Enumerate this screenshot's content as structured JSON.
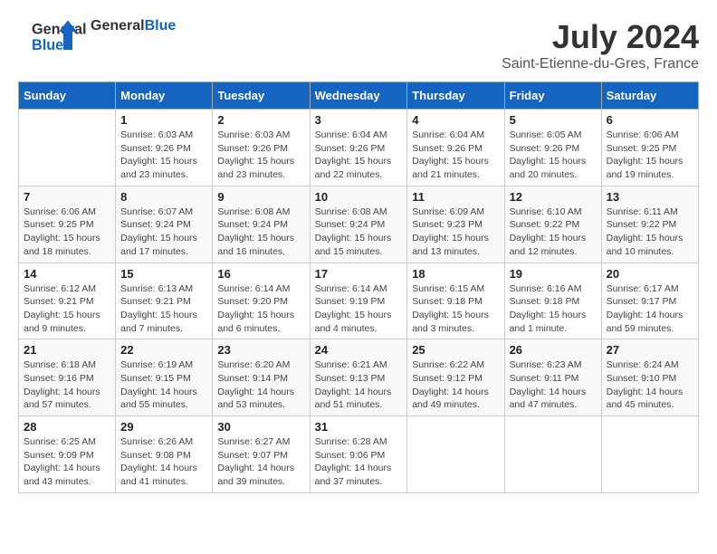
{
  "header": {
    "logo_general": "General",
    "logo_blue": "Blue",
    "month": "July 2024",
    "location": "Saint-Etienne-du-Gres, France"
  },
  "weekdays": [
    "Sunday",
    "Monday",
    "Tuesday",
    "Wednesday",
    "Thursday",
    "Friday",
    "Saturday"
  ],
  "weeks": [
    [
      {
        "day": "",
        "info": ""
      },
      {
        "day": "1",
        "info": "Sunrise: 6:03 AM\nSunset: 9:26 PM\nDaylight: 15 hours\nand 23 minutes."
      },
      {
        "day": "2",
        "info": "Sunrise: 6:03 AM\nSunset: 9:26 PM\nDaylight: 15 hours\nand 23 minutes."
      },
      {
        "day": "3",
        "info": "Sunrise: 6:04 AM\nSunset: 9:26 PM\nDaylight: 15 hours\nand 22 minutes."
      },
      {
        "day": "4",
        "info": "Sunrise: 6:04 AM\nSunset: 9:26 PM\nDaylight: 15 hours\nand 21 minutes."
      },
      {
        "day": "5",
        "info": "Sunrise: 6:05 AM\nSunset: 9:26 PM\nDaylight: 15 hours\nand 20 minutes."
      },
      {
        "day": "6",
        "info": "Sunrise: 6:06 AM\nSunset: 9:25 PM\nDaylight: 15 hours\nand 19 minutes."
      }
    ],
    [
      {
        "day": "7",
        "info": "Sunrise: 6:06 AM\nSunset: 9:25 PM\nDaylight: 15 hours\nand 18 minutes."
      },
      {
        "day": "8",
        "info": "Sunrise: 6:07 AM\nSunset: 9:24 PM\nDaylight: 15 hours\nand 17 minutes."
      },
      {
        "day": "9",
        "info": "Sunrise: 6:08 AM\nSunset: 9:24 PM\nDaylight: 15 hours\nand 16 minutes."
      },
      {
        "day": "10",
        "info": "Sunrise: 6:08 AM\nSunset: 9:24 PM\nDaylight: 15 hours\nand 15 minutes."
      },
      {
        "day": "11",
        "info": "Sunrise: 6:09 AM\nSunset: 9:23 PM\nDaylight: 15 hours\nand 13 minutes."
      },
      {
        "day": "12",
        "info": "Sunrise: 6:10 AM\nSunset: 9:22 PM\nDaylight: 15 hours\nand 12 minutes."
      },
      {
        "day": "13",
        "info": "Sunrise: 6:11 AM\nSunset: 9:22 PM\nDaylight: 15 hours\nand 10 minutes."
      }
    ],
    [
      {
        "day": "14",
        "info": "Sunrise: 6:12 AM\nSunset: 9:21 PM\nDaylight: 15 hours\nand 9 minutes."
      },
      {
        "day": "15",
        "info": "Sunrise: 6:13 AM\nSunset: 9:21 PM\nDaylight: 15 hours\nand 7 minutes."
      },
      {
        "day": "16",
        "info": "Sunrise: 6:14 AM\nSunset: 9:20 PM\nDaylight: 15 hours\nand 6 minutes."
      },
      {
        "day": "17",
        "info": "Sunrise: 6:14 AM\nSunset: 9:19 PM\nDaylight: 15 hours\nand 4 minutes."
      },
      {
        "day": "18",
        "info": "Sunrise: 6:15 AM\nSunset: 9:18 PM\nDaylight: 15 hours\nand 3 minutes."
      },
      {
        "day": "19",
        "info": "Sunrise: 6:16 AM\nSunset: 9:18 PM\nDaylight: 15 hours\nand 1 minute."
      },
      {
        "day": "20",
        "info": "Sunrise: 6:17 AM\nSunset: 9:17 PM\nDaylight: 14 hours\nand 59 minutes."
      }
    ],
    [
      {
        "day": "21",
        "info": "Sunrise: 6:18 AM\nSunset: 9:16 PM\nDaylight: 14 hours\nand 57 minutes."
      },
      {
        "day": "22",
        "info": "Sunrise: 6:19 AM\nSunset: 9:15 PM\nDaylight: 14 hours\nand 55 minutes."
      },
      {
        "day": "23",
        "info": "Sunrise: 6:20 AM\nSunset: 9:14 PM\nDaylight: 14 hours\nand 53 minutes."
      },
      {
        "day": "24",
        "info": "Sunrise: 6:21 AM\nSunset: 9:13 PM\nDaylight: 14 hours\nand 51 minutes."
      },
      {
        "day": "25",
        "info": "Sunrise: 6:22 AM\nSunset: 9:12 PM\nDaylight: 14 hours\nand 49 minutes."
      },
      {
        "day": "26",
        "info": "Sunrise: 6:23 AM\nSunset: 9:11 PM\nDaylight: 14 hours\nand 47 minutes."
      },
      {
        "day": "27",
        "info": "Sunrise: 6:24 AM\nSunset: 9:10 PM\nDaylight: 14 hours\nand 45 minutes."
      }
    ],
    [
      {
        "day": "28",
        "info": "Sunrise: 6:25 AM\nSunset: 9:09 PM\nDaylight: 14 hours\nand 43 minutes."
      },
      {
        "day": "29",
        "info": "Sunrise: 6:26 AM\nSunset: 9:08 PM\nDaylight: 14 hours\nand 41 minutes."
      },
      {
        "day": "30",
        "info": "Sunrise: 6:27 AM\nSunset: 9:07 PM\nDaylight: 14 hours\nand 39 minutes."
      },
      {
        "day": "31",
        "info": "Sunrise: 6:28 AM\nSunset: 9:06 PM\nDaylight: 14 hours\nand 37 minutes."
      },
      {
        "day": "",
        "info": ""
      },
      {
        "day": "",
        "info": ""
      },
      {
        "day": "",
        "info": ""
      }
    ]
  ]
}
